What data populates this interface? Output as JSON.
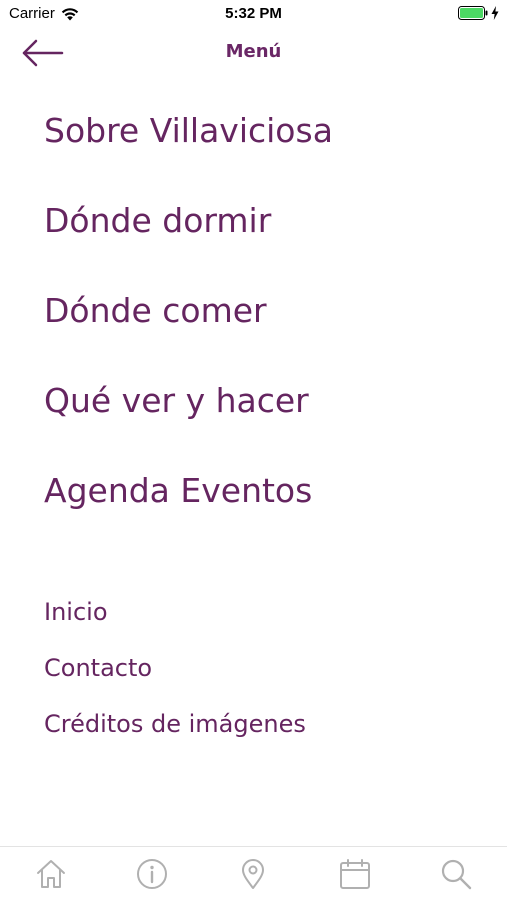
{
  "status_bar": {
    "carrier": "Carrier",
    "time": "5:32 PM"
  },
  "header": {
    "title": "Menú",
    "back_icon": "arrow-left-icon"
  },
  "primary_menu": [
    {
      "label": "Sobre Villaviciosa"
    },
    {
      "label": "Dónde dormir"
    },
    {
      "label": "Dónde comer"
    },
    {
      "label": "Qué ver y hacer"
    },
    {
      "label": "Agenda Eventos"
    }
  ],
  "secondary_menu": [
    {
      "label": "Inicio"
    },
    {
      "label": "Contacto"
    },
    {
      "label": "Créditos de imágenes"
    }
  ],
  "tab_bar": [
    {
      "icon": "home-icon"
    },
    {
      "icon": "info-icon"
    },
    {
      "icon": "location-pin-icon"
    },
    {
      "icon": "calendar-icon"
    },
    {
      "icon": "search-icon"
    }
  ],
  "colors": {
    "accent": "#652560",
    "tab_icon": "#b0b0b0",
    "battery": "#4cd964"
  }
}
